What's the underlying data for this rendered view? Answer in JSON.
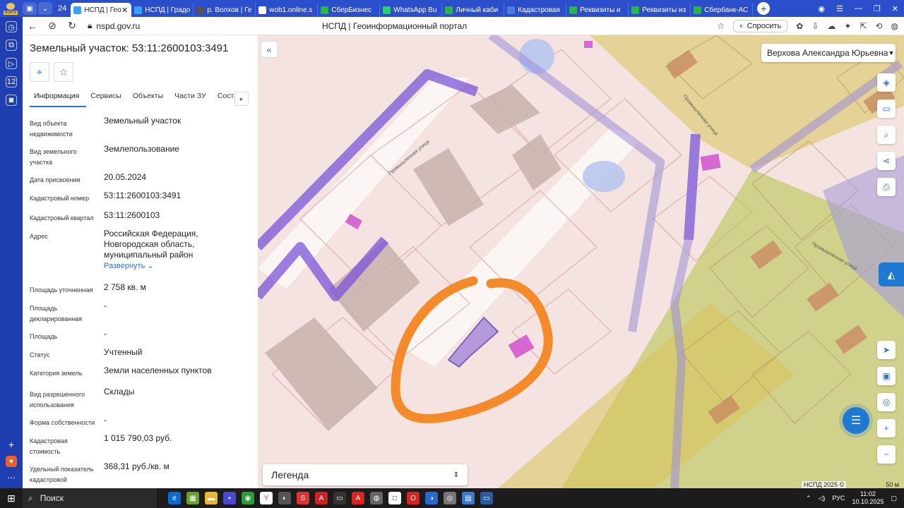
{
  "browser": {
    "login_label": "Войти",
    "tab_count": "24",
    "tabs": [
      {
        "label": "НСПД | Гео",
        "color": "#3aa0ff",
        "active": true
      },
      {
        "label": "НСПД | Градо",
        "color": "#3aa0ff"
      },
      {
        "label": "р. Волхов | Ге",
        "color": "#555555"
      },
      {
        "label": "wob1.online.s",
        "color": "#ffffff"
      },
      {
        "label": "СберБизнес",
        "color": "#2cb34a"
      },
      {
        "label": "WhatsApp Bu",
        "color": "#25d366"
      },
      {
        "label": "Личный каби",
        "color": "#2cb34a"
      },
      {
        "label": "Кадастровая",
        "color": "#4a7ce0"
      },
      {
        "label": "Реквизиты и",
        "color": "#2cb34a"
      },
      {
        "label": "Реквизиты из",
        "color": "#2cb34a"
      },
      {
        "label": "Сбербанк-АС",
        "color": "#2cb34a"
      }
    ],
    "url": "nspd.gov.ru",
    "page_title": "НСПД | Геоинформационный портал",
    "ask_button": "Спросить"
  },
  "panel": {
    "title": "Земельный участок: 53:11:2600103:3491",
    "tabs": [
      "Информация",
      "Сервисы",
      "Объекты",
      "Части ЗУ",
      "Соста"
    ],
    "rows": [
      {
        "key": "Вид объекта недвижимости",
        "value": "Земельный участок"
      },
      {
        "key": "Вид земельного участка",
        "value": "Землепользование"
      },
      {
        "key": "Дата присвоения",
        "value": "20.05.2024"
      },
      {
        "key": "Кадастровый номер",
        "value": "53:11:2600103:3491"
      },
      {
        "key": "Кадастровый квартал",
        "value": "53:11:2600103"
      },
      {
        "key": "Адрес",
        "value": "Российская Федерация, Новгородская область, муниципальный район",
        "link": "Развернуть"
      },
      {
        "key": "Площадь уточненная",
        "value": "2 758 кв. м"
      },
      {
        "key": "Площадь декларированная",
        "value": "-"
      },
      {
        "key": "Площадь",
        "value": "-"
      },
      {
        "key": "Статус",
        "value": "Учтенный"
      },
      {
        "key": "Категория земель",
        "value": "Земли населенных пунктов"
      },
      {
        "key": "Вид разрешенного использования",
        "value": "Склады"
      },
      {
        "key": "Форма собственности",
        "value": "-"
      },
      {
        "key": "Кадастровая стоимость",
        "value": "1 015 790,03 руб."
      },
      {
        "key": "Удельный показатель кадастровой",
        "value": "368,31 руб./кв. м"
      }
    ]
  },
  "map": {
    "user": "Верхова Александра Юрьевна",
    "legend": "Легенда",
    "copyright": "НСПД 2025 ©",
    "scale": "50 м",
    "streets": [
      "Промышленная улица",
      "Промышленная улица",
      "Промышленная улица"
    ]
  },
  "taskbar": {
    "search": "Поиск",
    "lang": "РУС",
    "time": "11:02",
    "date": "10.10.2025"
  }
}
